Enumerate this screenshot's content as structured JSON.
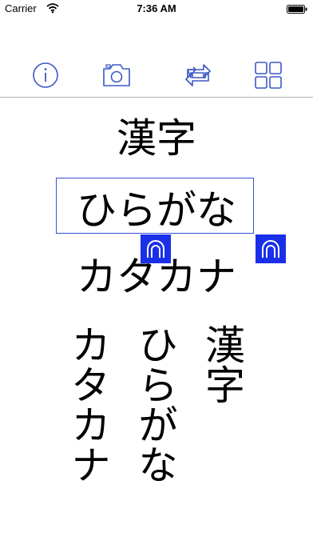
{
  "status_bar": {
    "carrier": "Carrier",
    "time": "7:36 AM"
  },
  "toolbar": {
    "buttons": [
      {
        "icon": "info-icon"
      },
      {
        "icon": "camera-icon"
      },
      {
        "icon": "rotate-arrows-icon"
      },
      {
        "icon": "grid-icon"
      }
    ],
    "accent": "#3b58c4"
  },
  "horizontal": {
    "row1": "漢字",
    "row2": "ひらがな",
    "row3": "カタカナ"
  },
  "vertical": {
    "col1": "カタカナ",
    "col2": "ひらがな",
    "col3": "漢字"
  },
  "colors": {
    "selection_border": "#3a4fd8",
    "handle_fill": "#1a2fe8"
  }
}
